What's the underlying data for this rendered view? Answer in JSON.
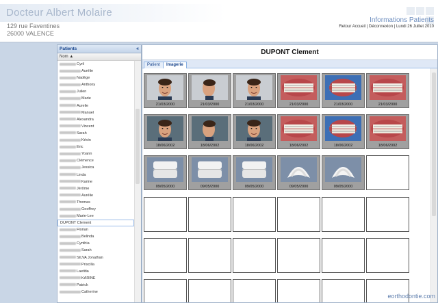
{
  "header": {
    "doctor_name": "Docteur Albert Molaire",
    "address_line1": "129 rue Faventines",
    "address_line2": "26000 VALENCE",
    "section_title": "Informations Patients",
    "link_home": "Retour Accueil",
    "separator": "|",
    "link_logout": "Déconnexion",
    "date": "Lundi 26 Juillet 2010"
  },
  "left_panel": {
    "title": "Patients",
    "collapse_icon": "«",
    "column_header": "Nom ▲",
    "patients": [
      {
        "first": "Cyril"
      },
      {
        "first": "Aurélie"
      },
      {
        "first": "Nadège"
      },
      {
        "first": "Anthony"
      },
      {
        "first": "Julien"
      },
      {
        "first": "Marie"
      },
      {
        "first": "Aurelie"
      },
      {
        "first": "Manuel"
      },
      {
        "first": "Alexandra"
      },
      {
        "first": "Vincent"
      },
      {
        "first": "Sarah"
      },
      {
        "first": "Kévin"
      },
      {
        "first": "Eric"
      },
      {
        "first": "Yoann"
      },
      {
        "first": "Clémence"
      },
      {
        "first": "Jessica"
      },
      {
        "first": "Linda"
      },
      {
        "first": "Karine"
      },
      {
        "first": "Jérôme"
      },
      {
        "first": "Aurélie"
      },
      {
        "first": "Thomas"
      },
      {
        "first": "Geoffrey"
      },
      {
        "first": "Marie-Lee"
      },
      {
        "full": "DUPONT Clement",
        "selected": true
      },
      {
        "first": "Florian"
      },
      {
        "first": "Belinda"
      },
      {
        "first": "Cynthia"
      },
      {
        "first": "Sarah"
      },
      {
        "first": "SILVA Jonathan"
      },
      {
        "first": "Priscilla"
      },
      {
        "first": "Laetitia"
      },
      {
        "first": "KARINE"
      },
      {
        "first": "Patrick"
      },
      {
        "first": "Catherine"
      }
    ]
  },
  "main_panel": {
    "patient_name": "DUPONT Clement",
    "tabs": [
      {
        "label": "Patient",
        "active": false
      },
      {
        "label": "Imagerie",
        "active": true
      }
    ],
    "rows": [
      [
        {
          "date": "21/03/2000",
          "kind": "face-front"
        },
        {
          "date": "21/03/2000",
          "kind": "face-profile"
        },
        {
          "date": "21/03/2000",
          "kind": "face-smile"
        },
        {
          "date": "21/03/2000",
          "kind": "teeth-front"
        },
        {
          "date": "21/03/2000",
          "kind": "teeth-side"
        },
        {
          "date": "21/03/2000",
          "kind": "teeth-front"
        }
      ],
      [
        {
          "date": "18/06/2002",
          "kind": "face-front-dark"
        },
        {
          "date": "18/06/2002",
          "kind": "face-profile-dark"
        },
        {
          "date": "18/06/2002",
          "kind": "face-smile-dark"
        },
        {
          "date": "18/06/2002",
          "kind": "teeth-front"
        },
        {
          "date": "18/06/2002",
          "kind": "teeth-side"
        },
        {
          "date": "18/06/2002",
          "kind": "teeth-front"
        }
      ],
      [
        {
          "date": "09/05/2000",
          "kind": "model"
        },
        {
          "date": "09/05/2000",
          "kind": "model"
        },
        {
          "date": "09/05/2000",
          "kind": "model"
        },
        {
          "date": "09/05/2000",
          "kind": "arch"
        },
        {
          "date": "09/05/2000",
          "kind": "arch"
        },
        {
          "date": "",
          "kind": "empty"
        }
      ],
      [
        {
          "date": "",
          "kind": "empty"
        },
        {
          "date": "",
          "kind": "empty"
        },
        {
          "date": "",
          "kind": "empty"
        },
        {
          "date": "",
          "kind": "empty"
        },
        {
          "date": "",
          "kind": "empty"
        },
        {
          "date": "",
          "kind": "empty"
        }
      ],
      [
        {
          "date": "",
          "kind": "empty"
        },
        {
          "date": "",
          "kind": "empty"
        },
        {
          "date": "",
          "kind": "empty"
        },
        {
          "date": "",
          "kind": "empty"
        },
        {
          "date": "",
          "kind": "empty"
        },
        {
          "date": "",
          "kind": "empty"
        }
      ],
      [
        {
          "date": "",
          "kind": "empty"
        },
        {
          "date": "",
          "kind": "empty"
        },
        {
          "date": "",
          "kind": "empty"
        },
        {
          "date": "",
          "kind": "empty"
        },
        {
          "date": "",
          "kind": "empty"
        },
        {
          "date": "",
          "kind": "empty"
        }
      ]
    ]
  },
  "watermark": "eorthodontie.com",
  "colors": {
    "header_title": "#a8b7cc",
    "accent_blue": "#6f8fbf",
    "panel_border": "#9fb1c8",
    "page_bg": "#c9d6e6"
  }
}
